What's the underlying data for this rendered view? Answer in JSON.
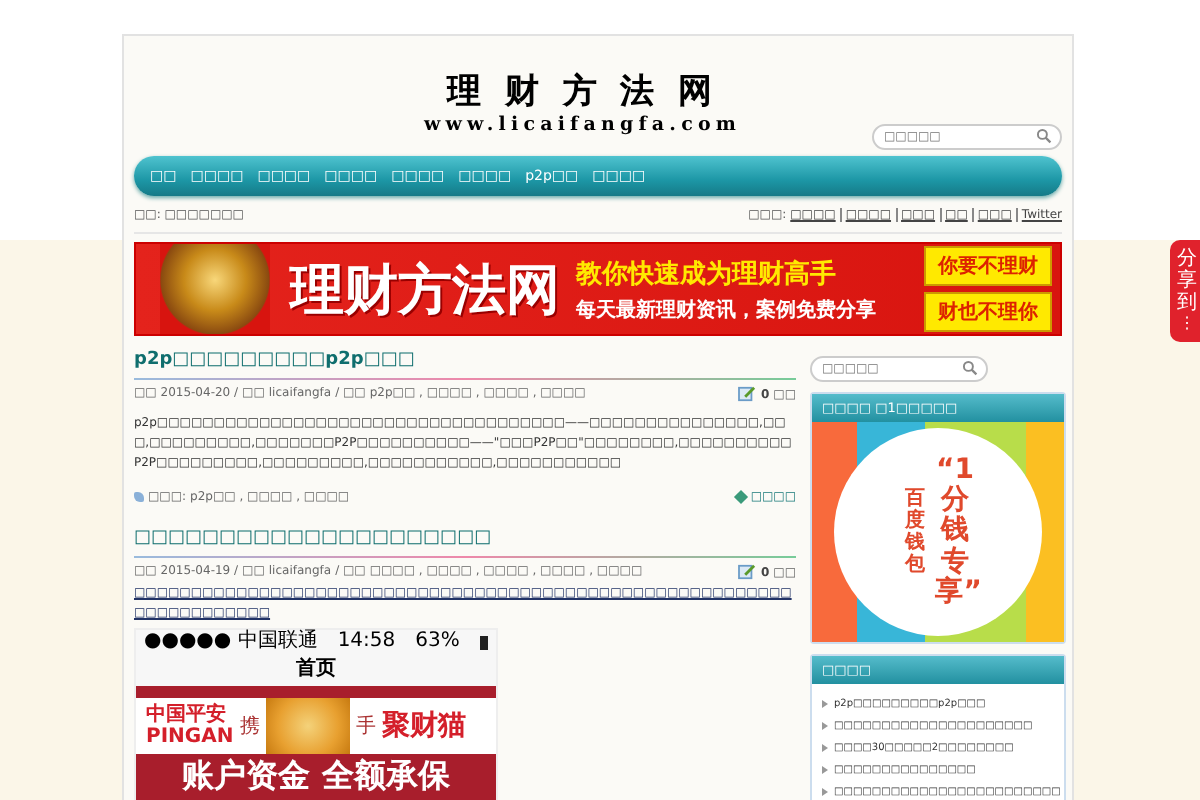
{
  "logo": {
    "title": "理 财 方 法 网",
    "url": "www.licaifangfa.com"
  },
  "header_search": {
    "placeholder": "□□□□□"
  },
  "nav": [
    {
      "label": "□□"
    },
    {
      "label": "□□□□"
    },
    {
      "label": "□□□□"
    },
    {
      "label": "□□□□"
    },
    {
      "label": "□□□□"
    },
    {
      "label": "□□□□"
    },
    {
      "label": "p2p□□"
    },
    {
      "label": "□□□□"
    }
  ],
  "breadcrumb": "□□: □□□□□□□",
  "top_links": {
    "label": "□□□:",
    "links": [
      "□□□□",
      "□□□□",
      "□□□",
      "□□",
      "□□□",
      "Twitter"
    ]
  },
  "banner": {
    "title": "理财方法网",
    "slogan": "教你快速成为理财高手",
    "subtitle": "每天最新理财资讯，案例免费分享",
    "buttons": [
      "你要不理财",
      "财也不理你"
    ]
  },
  "posts": [
    {
      "title": "p2p□□□□□□□□□p2p□□□",
      "date_label": "□□",
      "date": "2015-04-20 /",
      "author_label": "□□",
      "author": "licaifangfa",
      "category_label": "/ □□",
      "categories": "p2p□□ , □□□□ , □□□□ , □□□□",
      "comments": "0",
      "comments_label": "□□",
      "excerpt": "p2p□□□□□□□□□□□□□□□□□□□□□□□□□□□□□□□□□□□□——□□□□□□□□□□□□□□□,□□□,□□□□□□□□□,□□□□□□□P2P□□□□□□□□□□——\"□□□P2P□□\"□□□□□□□□,□□□□□□□□□□P2P□□□□□□□□□,□□□□□□□□□,□□□□□□□□□□□,□□□□□□□□□□□",
      "tags_label": "□□□:",
      "tags": "p2p□□ , □□□□ , □□□□",
      "read_more": "□□□□"
    },
    {
      "title": "□□□□□□□□□□□□□□□□□□□□□",
      "date_label": "□□",
      "date": "2015-04-19 /",
      "author_label": "□□",
      "author": "licaifangfa",
      "category_label": "/ □□",
      "categories": "□□□□ , □□□□ , □□□□ , □□□□ , □□□□",
      "comments": "0",
      "comments_label": "□□",
      "excerpt": "□□□□□□□□□□□□□□□□□□□□□□□□□□□□□□□□□□□□□□□□□□□□□□□□□□□□□□□□□□□□□□□□□□□□□□",
      "screenshot": {
        "carrier": "●●●●● 中国联通",
        "time": "14:58",
        "battery": "63%",
        "title": "首页",
        "brand_left": "中国平安",
        "brand_left_en": "PINGAN",
        "join_left": "携",
        "join_right": "手",
        "brand_right": "聚财猫",
        "headline": "账户资金 全额承保"
      }
    }
  ],
  "sidebar": {
    "search": {
      "placeholder": "□□□□□"
    },
    "widgets": [
      {
        "kind": "promo",
        "title": "□□□□ □1□□□□□",
        "promo": {
          "big": "“1分钱专享”",
          "small": "百度钱包"
        }
      },
      {
        "kind": "list",
        "title": "□□□□",
        "items": [
          "p2p□□□□□□□□□p2p□□□",
          "□□□□□□□□□□□□□□□□□□□□□",
          "□□□□30□□□□□2□□□□□□□□",
          "□□□□□□□□□□□□□□□",
          "□□□□□□□□□□□□□□□□□□□□□□□□"
        ]
      }
    ]
  },
  "share": {
    "label": "分享到",
    "dots": "⋮"
  }
}
